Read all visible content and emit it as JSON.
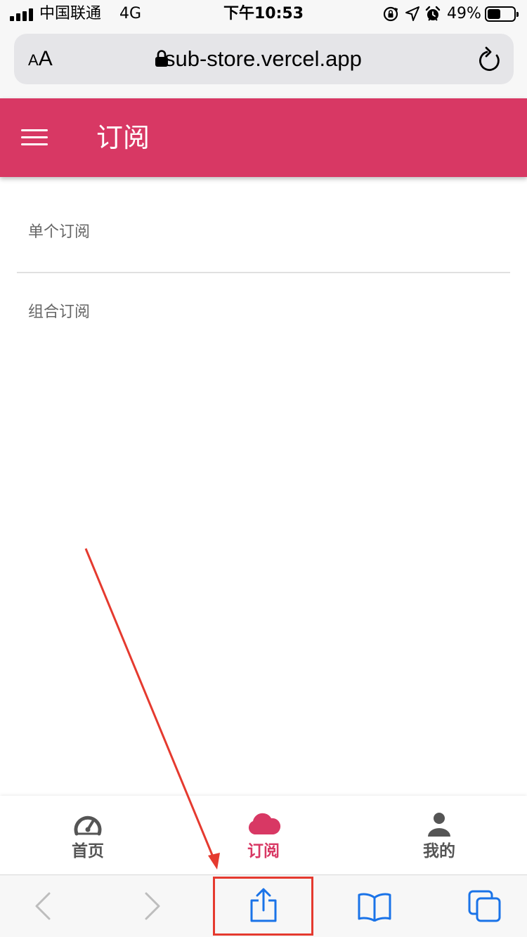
{
  "status_bar": {
    "carrier": "中国联通",
    "network": "4G",
    "time": "下午10:53",
    "battery_percent": "49%",
    "battery_level": 0.49,
    "icons": [
      "orientation-lock-icon",
      "location-arrow-icon",
      "alarm-icon"
    ]
  },
  "browser": {
    "text_size_label": "AA",
    "url": "sub-store.vercel.app",
    "toolbar_buttons": [
      "back-icon",
      "forward-icon",
      "share-icon",
      "bookmarks-icon",
      "tabs-icon"
    ]
  },
  "app_bar": {
    "title": "订阅"
  },
  "list": {
    "items": [
      {
        "label": "单个订阅"
      },
      {
        "label": "组合订阅"
      }
    ]
  },
  "bottom_nav": {
    "items": [
      {
        "label": "首页",
        "icon": "speedometer-icon",
        "active": false
      },
      {
        "label": "订阅",
        "icon": "cloud-icon",
        "active": true
      },
      {
        "label": "我的",
        "icon": "person-icon",
        "active": false
      }
    ]
  },
  "colors": {
    "primary": "#d83864",
    "inactive_nav": "#555555",
    "ios_blue": "#1a73e8",
    "annotation_red": "#e53a2f"
  }
}
